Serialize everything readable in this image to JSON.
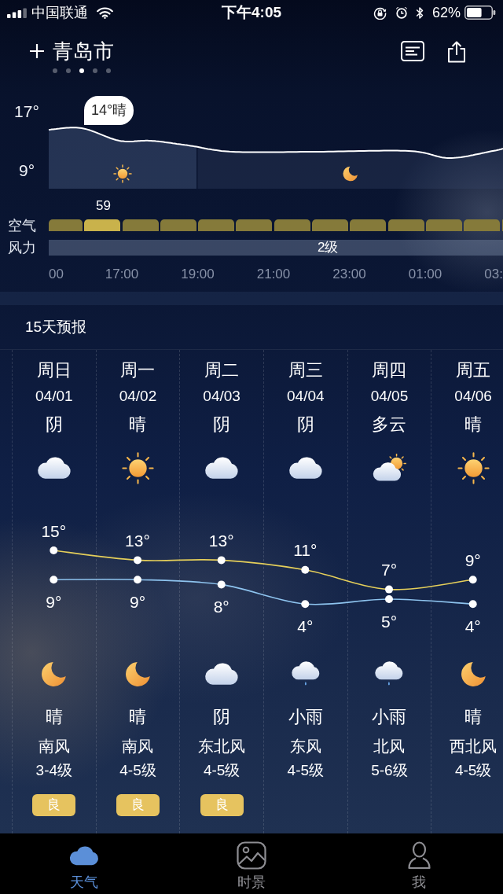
{
  "status_bar": {
    "carrier": "中国联通",
    "time": "下午4:05",
    "battery": "62%"
  },
  "header": {
    "city": "青岛市",
    "page_dots": [
      {
        "selected": false
      },
      {
        "selected": false
      },
      {
        "selected": true
      },
      {
        "selected": false
      },
      {
        "selected": false
      }
    ]
  },
  "hourly": {
    "scale_labels": [
      "17°",
      "9°"
    ],
    "callout": "14°晴",
    "periods": [
      {
        "kind": "day"
      },
      {
        "kind": "night"
      }
    ],
    "air": {
      "label": "空气",
      "segments": [
        {
          "selected": false
        },
        {
          "selected": true,
          "value": "59"
        },
        {
          "selected": false
        },
        {
          "selected": false
        },
        {
          "selected": false
        },
        {
          "selected": false
        },
        {
          "selected": false
        },
        {
          "selected": false
        },
        {
          "selected": false
        },
        {
          "selected": false
        },
        {
          "selected": false
        },
        {
          "selected": false
        },
        {
          "selected": false
        }
      ]
    },
    "wind": {
      "label": "风力",
      "value": "2级"
    },
    "time_labels": [
      "00",
      "17:00",
      "19:00",
      "21:00",
      "23:00",
      "01:00",
      "03:"
    ]
  },
  "forecast": {
    "title": "15天预报",
    "days": [
      {
        "weekday": "周日",
        "date": "04/01",
        "day": {
          "kind": "cloud",
          "condition": "阴"
        },
        "night": {
          "kind": "moon",
          "condition": "晴"
        },
        "wind_direction": "南风",
        "wind_level": "3-4级",
        "air_quality": "良"
      },
      {
        "weekday": "周一",
        "date": "04/02",
        "day": {
          "kind": "sun",
          "condition": "晴"
        },
        "night": {
          "kind": "moon",
          "condition": "晴"
        },
        "wind_direction": "南风",
        "wind_level": "4-5级",
        "air_quality": "良"
      },
      {
        "weekday": "周二",
        "date": "04/03",
        "day": {
          "kind": "cloud",
          "condition": "阴"
        },
        "night": {
          "kind": "cloud",
          "condition": "阴"
        },
        "wind_direction": "东北风",
        "wind_level": "4-5级",
        "air_quality": "良"
      },
      {
        "weekday": "周三",
        "date": "04/04",
        "day": {
          "kind": "cloud",
          "condition": "阴"
        },
        "night": {
          "kind": "rain",
          "condition": "小雨"
        },
        "wind_direction": "东风",
        "wind_level": "4-5级"
      },
      {
        "weekday": "周四",
        "date": "04/05",
        "day": {
          "kind": "partly_cloudy",
          "condition": "多云"
        },
        "night": {
          "kind": "rain",
          "condition": "小雨"
        },
        "wind_direction": "北风",
        "wind_level": "5-6级"
      },
      {
        "weekday": "周五",
        "date": "04/06",
        "day": {
          "kind": "sun",
          "condition": "晴"
        },
        "night": {
          "kind": "moon",
          "condition": "晴"
        },
        "wind_direction": "西北风",
        "wind_level": "4-5级"
      }
    ],
    "chart_data": {
      "type": "line",
      "data_labels": true,
      "series": [
        {
          "color": "#e5cf5a",
          "marker": "circle",
          "values": [
            15,
            13,
            13,
            11,
            7,
            9
          ],
          "value_labels": [
            "15°",
            "13°",
            "13°",
            "11°",
            "7°",
            "9°"
          ]
        },
        {
          "color": "#8ec4ef",
          "marker": "circle",
          "values": [
            9,
            9,
            8,
            4,
            5,
            4
          ],
          "value_labels": [
            "9°",
            "9°",
            "8°",
            "4°",
            "5°",
            "4°"
          ]
        }
      ]
    }
  },
  "tab_bar": [
    {
      "label": "天气",
      "selected": true
    },
    {
      "label": "时景",
      "selected": false
    },
    {
      "label": "我",
      "selected": false
    }
  ]
}
